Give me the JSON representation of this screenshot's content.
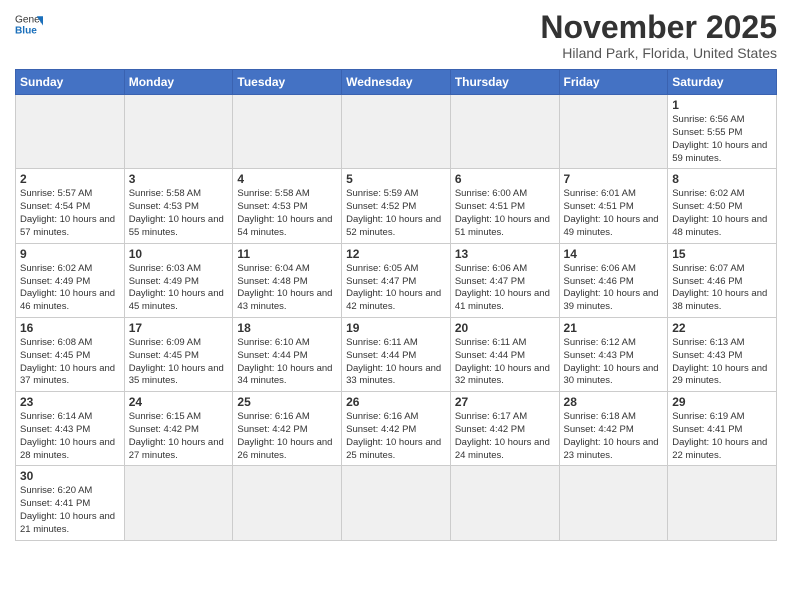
{
  "header": {
    "logo_general": "General",
    "logo_blue": "Blue",
    "month_title": "November 2025",
    "location": "Hiland Park, Florida, United States"
  },
  "weekdays": [
    "Sunday",
    "Monday",
    "Tuesday",
    "Wednesday",
    "Thursday",
    "Friday",
    "Saturday"
  ],
  "weeks": [
    [
      {
        "day": "",
        "info": ""
      },
      {
        "day": "",
        "info": ""
      },
      {
        "day": "",
        "info": ""
      },
      {
        "day": "",
        "info": ""
      },
      {
        "day": "",
        "info": ""
      },
      {
        "day": "",
        "info": ""
      },
      {
        "day": "1",
        "info": "Sunrise: 6:56 AM\nSunset: 5:55 PM\nDaylight: 10 hours and 59 minutes."
      }
    ],
    [
      {
        "day": "2",
        "info": "Sunrise: 5:57 AM\nSunset: 4:54 PM\nDaylight: 10 hours and 57 minutes."
      },
      {
        "day": "3",
        "info": "Sunrise: 5:58 AM\nSunset: 4:53 PM\nDaylight: 10 hours and 55 minutes."
      },
      {
        "day": "4",
        "info": "Sunrise: 5:58 AM\nSunset: 4:53 PM\nDaylight: 10 hours and 54 minutes."
      },
      {
        "day": "5",
        "info": "Sunrise: 5:59 AM\nSunset: 4:52 PM\nDaylight: 10 hours and 52 minutes."
      },
      {
        "day": "6",
        "info": "Sunrise: 6:00 AM\nSunset: 4:51 PM\nDaylight: 10 hours and 51 minutes."
      },
      {
        "day": "7",
        "info": "Sunrise: 6:01 AM\nSunset: 4:51 PM\nDaylight: 10 hours and 49 minutes."
      },
      {
        "day": "8",
        "info": "Sunrise: 6:02 AM\nSunset: 4:50 PM\nDaylight: 10 hours and 48 minutes."
      }
    ],
    [
      {
        "day": "9",
        "info": "Sunrise: 6:02 AM\nSunset: 4:49 PM\nDaylight: 10 hours and 46 minutes."
      },
      {
        "day": "10",
        "info": "Sunrise: 6:03 AM\nSunset: 4:49 PM\nDaylight: 10 hours and 45 minutes."
      },
      {
        "day": "11",
        "info": "Sunrise: 6:04 AM\nSunset: 4:48 PM\nDaylight: 10 hours and 43 minutes."
      },
      {
        "day": "12",
        "info": "Sunrise: 6:05 AM\nSunset: 4:47 PM\nDaylight: 10 hours and 42 minutes."
      },
      {
        "day": "13",
        "info": "Sunrise: 6:06 AM\nSunset: 4:47 PM\nDaylight: 10 hours and 41 minutes."
      },
      {
        "day": "14",
        "info": "Sunrise: 6:06 AM\nSunset: 4:46 PM\nDaylight: 10 hours and 39 minutes."
      },
      {
        "day": "15",
        "info": "Sunrise: 6:07 AM\nSunset: 4:46 PM\nDaylight: 10 hours and 38 minutes."
      }
    ],
    [
      {
        "day": "16",
        "info": "Sunrise: 6:08 AM\nSunset: 4:45 PM\nDaylight: 10 hours and 37 minutes."
      },
      {
        "day": "17",
        "info": "Sunrise: 6:09 AM\nSunset: 4:45 PM\nDaylight: 10 hours and 35 minutes."
      },
      {
        "day": "18",
        "info": "Sunrise: 6:10 AM\nSunset: 4:44 PM\nDaylight: 10 hours and 34 minutes."
      },
      {
        "day": "19",
        "info": "Sunrise: 6:11 AM\nSunset: 4:44 PM\nDaylight: 10 hours and 33 minutes."
      },
      {
        "day": "20",
        "info": "Sunrise: 6:11 AM\nSunset: 4:44 PM\nDaylight: 10 hours and 32 minutes."
      },
      {
        "day": "21",
        "info": "Sunrise: 6:12 AM\nSunset: 4:43 PM\nDaylight: 10 hours and 30 minutes."
      },
      {
        "day": "22",
        "info": "Sunrise: 6:13 AM\nSunset: 4:43 PM\nDaylight: 10 hours and 29 minutes."
      }
    ],
    [
      {
        "day": "23",
        "info": "Sunrise: 6:14 AM\nSunset: 4:43 PM\nDaylight: 10 hours and 28 minutes."
      },
      {
        "day": "24",
        "info": "Sunrise: 6:15 AM\nSunset: 4:42 PM\nDaylight: 10 hours and 27 minutes."
      },
      {
        "day": "25",
        "info": "Sunrise: 6:16 AM\nSunset: 4:42 PM\nDaylight: 10 hours and 26 minutes."
      },
      {
        "day": "26",
        "info": "Sunrise: 6:16 AM\nSunset: 4:42 PM\nDaylight: 10 hours and 25 minutes."
      },
      {
        "day": "27",
        "info": "Sunrise: 6:17 AM\nSunset: 4:42 PM\nDaylight: 10 hours and 24 minutes."
      },
      {
        "day": "28",
        "info": "Sunrise: 6:18 AM\nSunset: 4:42 PM\nDaylight: 10 hours and 23 minutes."
      },
      {
        "day": "29",
        "info": "Sunrise: 6:19 AM\nSunset: 4:41 PM\nDaylight: 10 hours and 22 minutes."
      }
    ],
    [
      {
        "day": "30",
        "info": "Sunrise: 6:20 AM\nSunset: 4:41 PM\nDaylight: 10 hours and 21 minutes."
      },
      {
        "day": "",
        "info": ""
      },
      {
        "day": "",
        "info": ""
      },
      {
        "day": "",
        "info": ""
      },
      {
        "day": "",
        "info": ""
      },
      {
        "day": "",
        "info": ""
      },
      {
        "day": "",
        "info": ""
      }
    ]
  ]
}
